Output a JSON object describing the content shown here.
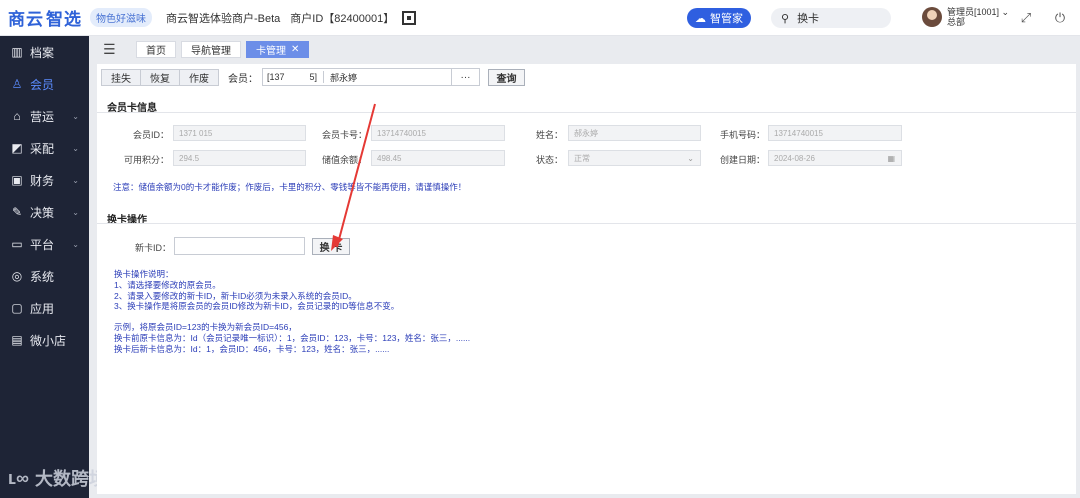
{
  "topbar": {
    "logo_a": "商云",
    "logo_b": "智选",
    "slogan": "物色好滋味",
    "merchant": "商云智选体验商户-Beta",
    "merchant_id": "商户ID【82400001】",
    "assistant_btn": "智管家",
    "search_value": "换卡",
    "user_name": "管理员[1001]",
    "user_role": "总部"
  },
  "sidebar": {
    "items": [
      {
        "icon": "archive-icon",
        "glyph": "▥",
        "label": "档案",
        "has_arrow": false
      },
      {
        "icon": "user-icon",
        "glyph": "♙",
        "label": "会员",
        "has_arrow": false,
        "active": true
      },
      {
        "icon": "shop-icon",
        "glyph": "⌂",
        "label": "营运",
        "has_arrow": true
      },
      {
        "icon": "cart-icon",
        "glyph": "◩",
        "label": "采配",
        "has_arrow": true
      },
      {
        "icon": "finance-icon",
        "glyph": "▣",
        "label": "财务",
        "has_arrow": true
      },
      {
        "icon": "decision-icon",
        "glyph": "✎",
        "label": "决策",
        "has_arrow": true
      },
      {
        "icon": "monitor-icon",
        "glyph": "▭",
        "label": "平台",
        "has_arrow": true
      },
      {
        "icon": "system-icon",
        "glyph": "◎",
        "label": "系统",
        "has_arrow": false
      },
      {
        "icon": "app-icon",
        "glyph": "▢",
        "label": "应用",
        "has_arrow": false
      },
      {
        "icon": "store-icon",
        "glyph": "▤",
        "label": "微小店",
        "has_arrow": false
      }
    ],
    "watermark": "大数跨境"
  },
  "tabs": [
    {
      "label": "首页",
      "active": false
    },
    {
      "label": "导航管理",
      "active": false
    },
    {
      "label": "卡管理",
      "active": true,
      "closable": true
    }
  ],
  "toolbar": {
    "buttons": [
      "挂失",
      "恢复",
      "作废"
    ],
    "member_label": "会员：",
    "member_id": "[137          5]",
    "member_name": "郝永婷",
    "dots": "···",
    "query": "查询"
  },
  "card_info": {
    "title": "会员卡信息",
    "fields": {
      "member_id": {
        "label": "会员ID：",
        "value": "1371        015"
      },
      "card_no": {
        "label": "会员卡号：",
        "value": "13714740015"
      },
      "name": {
        "label": "姓名：",
        "value": "郝永婷"
      },
      "phone": {
        "label": "手机号码：",
        "value": "13714740015"
      },
      "points": {
        "label": "可用积分：",
        "value": "294.5"
      },
      "balance": {
        "label": "储值余额：",
        "value": "498.45"
      },
      "status": {
        "label": "状态：",
        "value": "正常"
      },
      "created": {
        "label": "创建日期：",
        "value": "2024-08-26"
      }
    },
    "notice": "注意：储值余额为0的卡才能作废；作废后，卡里的积分、零钱等皆不能再使用，请谨慎操作！"
  },
  "swap": {
    "title": "换卡操作",
    "new_card_label": "新卡ID：",
    "new_card_value": "",
    "swap_btn": "换 卡",
    "instructions": [
      "换卡操作说明：",
      "1、请选择要修改的原会员。",
      "2、请录入要修改的新卡ID，新卡ID必须为未录入系统的会员ID。",
      "3、换卡操作是将原会员的会员ID修改为新卡ID，会员记录的ID等信息不变。"
    ],
    "examples": [
      "示例，将原会员ID=123的卡换为新会员ID=456，",
      "换卡前原卡信息为：Id（会员记录唯一标识）：1，会员ID：123，卡号：123，姓名：张三，......",
      "换卡后新卡信息为：Id：1，会员ID：456，卡号：123，姓名：张三，......"
    ]
  },
  "colors": {
    "accent": "#2f5fe0",
    "sidebar_bg": "#1e2436",
    "notice": "#2c3eb8",
    "arrow": "#e53935"
  }
}
